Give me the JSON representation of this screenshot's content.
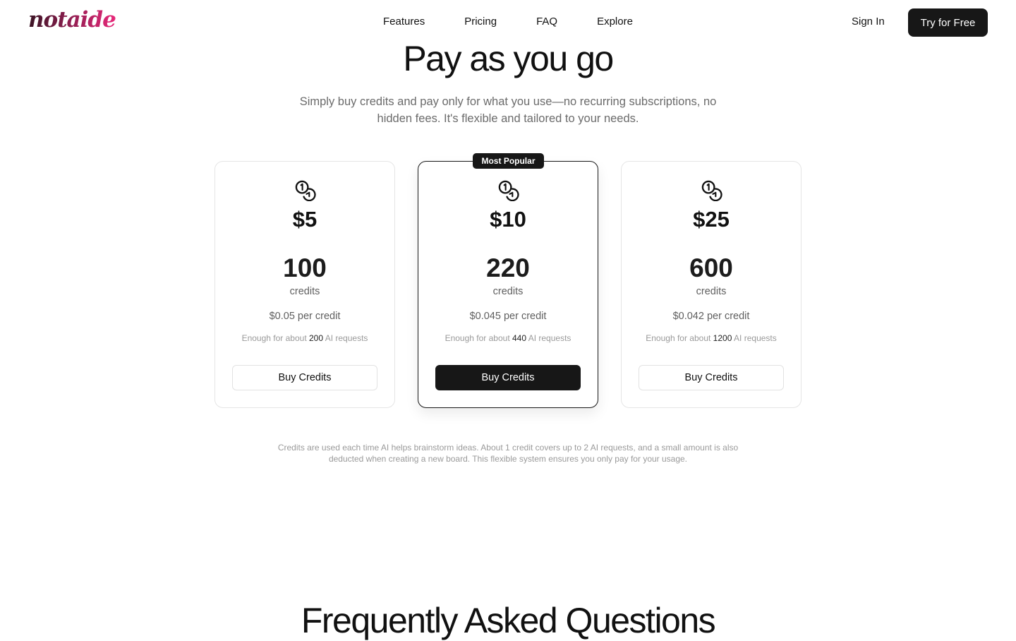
{
  "brand": {
    "logo_text": "notaide",
    "accent": "#e8287a"
  },
  "nav": {
    "links": [
      "Features",
      "Pricing",
      "FAQ",
      "Explore"
    ],
    "sign_in": "Sign In",
    "cta": "Try for Free"
  },
  "hero": {
    "title": "Pay as you go",
    "subtitle": "Simply buy credits and pay only for what you use—no recurring subscriptions, no hidden fees. It's flexible and tailored to your needs."
  },
  "plans": [
    {
      "icon": "coins-icon",
      "price": "$5",
      "credits": "100",
      "credits_label": "credits",
      "per_credit": "$0.05 per credit",
      "enough_prefix": "Enough for about",
      "requests": "200",
      "enough_suffix": "AI requests",
      "button": "Buy Credits"
    },
    {
      "icon": "coins-icon",
      "badge": "Most Popular",
      "price": "$10",
      "credits": "220",
      "credits_label": "credits",
      "per_credit": "$0.045 per credit",
      "enough_prefix": "Enough for about",
      "requests": "440",
      "enough_suffix": "AI requests",
      "button": "Buy Credits"
    },
    {
      "icon": "coins-icon",
      "price": "$25",
      "credits": "600",
      "credits_label": "credits",
      "per_credit": "$0.042 per credit",
      "enough_prefix": "Enough for about",
      "requests": "1200",
      "enough_suffix": "AI requests",
      "button": "Buy Credits"
    }
  ],
  "footnote": "Credits are used each time AI helps brainstorm ideas. About 1 credit covers up to 2 AI requests, and a small amount is also deducted when creating a new board. This flexible system ensures you only pay for your usage.",
  "faq": {
    "title": "Frequently Asked Questions"
  }
}
